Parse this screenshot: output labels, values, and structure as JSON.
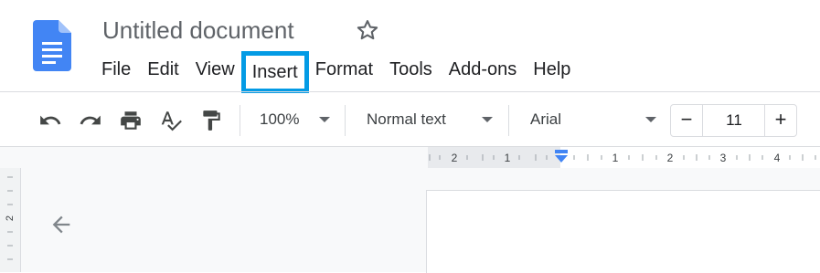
{
  "document": {
    "title": "Untitled document"
  },
  "menu": {
    "items": [
      "File",
      "Edit",
      "View",
      "Insert",
      "Format",
      "Tools",
      "Add-ons",
      "Help"
    ],
    "highlighted": "Insert",
    "highlight_color": "#039be5"
  },
  "toolbar": {
    "zoom": "100%",
    "style": "Normal text",
    "font": "Arial",
    "font_size": "11",
    "minus_label": "−",
    "plus_label": "+",
    "icons": [
      "undo-icon",
      "redo-icon",
      "print-icon",
      "spellcheck-icon",
      "paint-format-icon"
    ]
  },
  "ruler": {
    "labels": [
      "2",
      "1",
      "1",
      "2",
      "3",
      "4"
    ],
    "marker_color": "#4285f4"
  },
  "vertical_ruler": {
    "label": "2"
  },
  "colors": {
    "docs_blue": "#4285f4",
    "text": "#202124",
    "muted": "#5f6368"
  }
}
